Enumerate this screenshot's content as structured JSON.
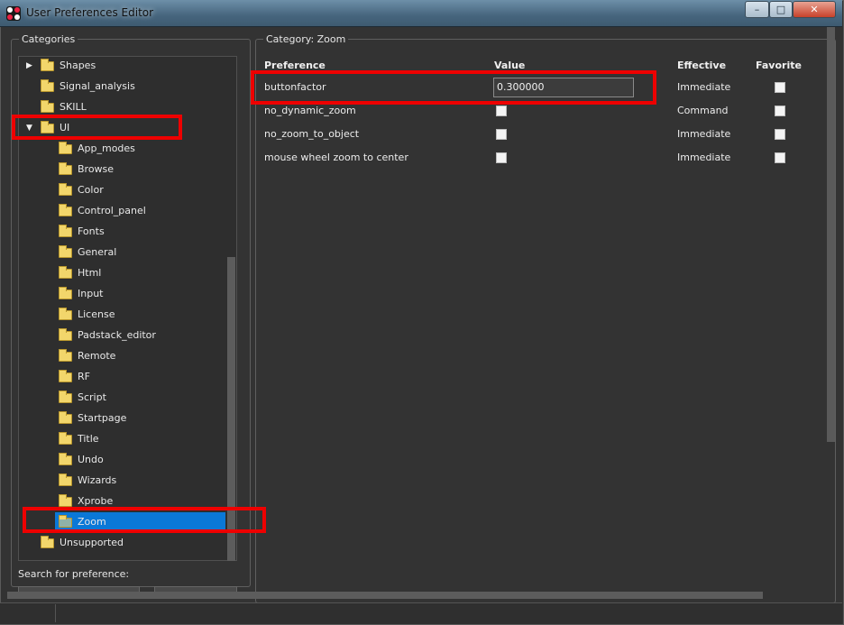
{
  "window": {
    "title": "User Preferences Editor",
    "min_label": "–",
    "max_label": "□",
    "close_label": "✕"
  },
  "categories": {
    "group_label": "Categories",
    "items": [
      {
        "label": "Shapes",
        "expander": "▶",
        "level": 0
      },
      {
        "label": "Signal_analysis",
        "expander": "",
        "level": 0
      },
      {
        "label": "SKILL",
        "expander": "",
        "level": 0
      },
      {
        "label": "UI",
        "expander": "▼",
        "level": 0
      },
      {
        "label": "App_modes",
        "expander": "",
        "level": 1
      },
      {
        "label": "Browse",
        "expander": "",
        "level": 1
      },
      {
        "label": "Color",
        "expander": "",
        "level": 1
      },
      {
        "label": "Control_panel",
        "expander": "",
        "level": 1
      },
      {
        "label": "Fonts",
        "expander": "",
        "level": 1
      },
      {
        "label": "General",
        "expander": "",
        "level": 1
      },
      {
        "label": "Html",
        "expander": "",
        "level": 1
      },
      {
        "label": "Input",
        "expander": "",
        "level": 1
      },
      {
        "label": "License",
        "expander": "",
        "level": 1
      },
      {
        "label": "Padstack_editor",
        "expander": "",
        "level": 1
      },
      {
        "label": "Remote",
        "expander": "",
        "level": 1
      },
      {
        "label": "RF",
        "expander": "",
        "level": 1
      },
      {
        "label": "Script",
        "expander": "",
        "level": 1
      },
      {
        "label": "Startpage",
        "expander": "",
        "level": 1
      },
      {
        "label": "Title",
        "expander": "",
        "level": 1
      },
      {
        "label": "Undo",
        "expander": "",
        "level": 1
      },
      {
        "label": "Wizards",
        "expander": "",
        "level": 1
      },
      {
        "label": "Xprobe",
        "expander": "",
        "level": 1
      },
      {
        "label": "Zoom",
        "expander": "",
        "level": 1,
        "selected": true
      },
      {
        "label": "Unsupported",
        "expander": "",
        "level": 0
      }
    ],
    "search_label": "Search for preference:"
  },
  "category_panel": {
    "group_label": "Category:  Zoom",
    "headers": {
      "preference": "Preference",
      "value": "Value",
      "effective": "Effective",
      "favorite": "Favorite"
    },
    "rows": [
      {
        "preference": "buttonfactor",
        "value": "0.300000",
        "value_type": "text",
        "effective": "Immediate",
        "favorite": false
      },
      {
        "preference": "no_dynamic_zoom",
        "value": "",
        "value_type": "checkbox",
        "effective": "Command",
        "favorite": false
      },
      {
        "preference": "no_zoom_to_object",
        "value": "",
        "value_type": "checkbox",
        "effective": "Immediate",
        "favorite": false
      },
      {
        "preference": "mouse wheel zoom to center",
        "value": "",
        "value_type": "checkbox",
        "effective": "Immediate",
        "favorite": false
      }
    ]
  },
  "colors": {
    "selection": "#0a78d7",
    "annotation": "#ee0000"
  }
}
